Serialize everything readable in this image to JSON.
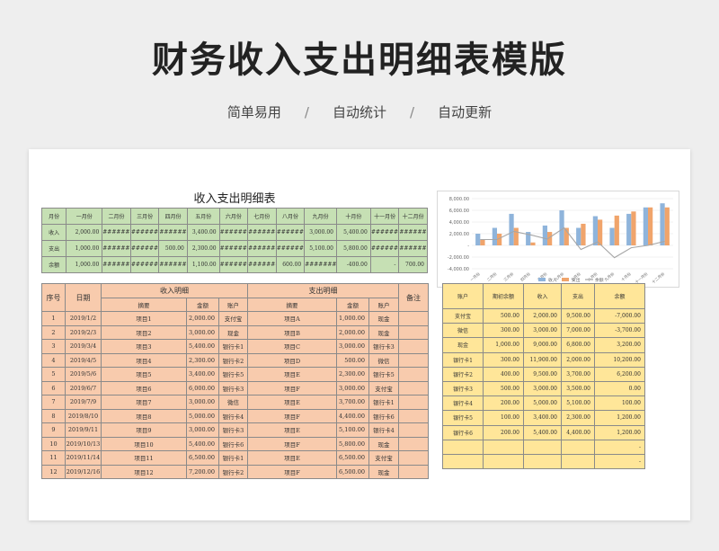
{
  "page": {
    "title": "财务收入支出明细表模版",
    "tags": [
      "简单易用",
      "自动统计",
      "自动更新"
    ],
    "separator": "/"
  },
  "monthly": {
    "title": "收入支出明细表",
    "columns": [
      "月份",
      "一月份",
      "二月份",
      "三月份",
      "四月份",
      "五月份",
      "六月份",
      "七月份",
      "八月份",
      "九月份",
      "十月份",
      "十一月份",
      "十二月份"
    ],
    "rows": [
      [
        "收入",
        "2,000.00",
        "########",
        "########",
        "########",
        "3,400.00",
        "########",
        "########",
        "########",
        "3,000.00",
        "5,400.00",
        "########",
        "########"
      ],
      [
        "支出",
        "1,000.00",
        "########",
        "########",
        "500.00",
        "2,300.00",
        "########",
        "########",
        "########",
        "5,100.00",
        "5,800.00",
        "########",
        "########"
      ],
      [
        "余额",
        "1,000.00",
        "########",
        "########",
        "########",
        "1,100.00",
        "########",
        "########",
        "600.00",
        "########",
        "-400.00",
        "-",
        "700.00"
      ]
    ]
  },
  "detail": {
    "headers": {
      "seq": "序号",
      "date": "日期",
      "income_group": "收入明细",
      "expense_group": "支出明细",
      "note": "备注",
      "summary": "摘要",
      "amount": "金额",
      "account": "账户"
    },
    "rows": [
      [
        "1",
        "2019/1/2",
        "项目1",
        "2,000.00",
        "支付宝",
        "项目A",
        "1,000.00",
        "现金"
      ],
      [
        "2",
        "2019/2/3",
        "项目2",
        "3,000.00",
        "现金",
        "项目B",
        "2,000.00",
        "现金"
      ],
      [
        "3",
        "2019/3/4",
        "项目3",
        "5,400.00",
        "银行卡1",
        "项目C",
        "3,000.00",
        "银行卡3"
      ],
      [
        "4",
        "2019/4/5",
        "项目4",
        "2,300.00",
        "银行卡2",
        "项目D",
        "500.00",
        "微信"
      ],
      [
        "5",
        "2019/5/6",
        "项目5",
        "3,400.00",
        "银行卡5",
        "项目E",
        "2,300.00",
        "银行卡5"
      ],
      [
        "6",
        "2019/6/7",
        "项目6",
        "6,000.00",
        "银行卡3",
        "项目F",
        "3,000.00",
        "支付宝"
      ],
      [
        "7",
        "2019/7/9",
        "项目7",
        "3,000.00",
        "微信",
        "项目E",
        "3,700.00",
        "银行卡1"
      ],
      [
        "8",
        "2019/8/10",
        "项目8",
        "5,000.00",
        "银行卡4",
        "项目F",
        "4,400.00",
        "银行卡6"
      ],
      [
        "9",
        "2019/9/11",
        "项目9",
        "3,000.00",
        "银行卡3",
        "项目E",
        "5,100.00",
        "银行卡4"
      ],
      [
        "10",
        "2019/10/13",
        "项目10",
        "5,400.00",
        "银行卡6",
        "项目F",
        "5,800.00",
        "现金"
      ],
      [
        "11",
        "2019/11/14",
        "项目11",
        "6,500.00",
        "银行卡1",
        "项目E",
        "6,500.00",
        "支付宝"
      ],
      [
        "12",
        "2019/12/16",
        "项目12",
        "7,200.00",
        "银行卡2",
        "项目F",
        "6,500.00",
        "现金"
      ]
    ]
  },
  "accounts": {
    "headers": [
      "账户",
      "期初余额",
      "收入",
      "支出",
      "余额"
    ],
    "rows": [
      [
        "支付宝",
        "500.00",
        "2,000.00",
        "9,500.00",
        "-7,000.00"
      ],
      [
        "微信",
        "300.00",
        "3,000.00",
        "7,000.00",
        "-3,700.00"
      ],
      [
        "现金",
        "1,000.00",
        "9,000.00",
        "6,800.00",
        "3,200.00"
      ],
      [
        "银行卡1",
        "300.00",
        "11,900.00",
        "2,000.00",
        "10,200.00"
      ],
      [
        "银行卡2",
        "400.00",
        "9,500.00",
        "3,700.00",
        "6,200.00"
      ],
      [
        "银行卡3",
        "500.00",
        "3,000.00",
        "3,500.00",
        "0.00"
      ],
      [
        "银行卡4",
        "200.00",
        "5,000.00",
        "5,100.00",
        "100.00"
      ],
      [
        "银行卡5",
        "100.00",
        "3,400.00",
        "2,300.00",
        "1,200.00"
      ],
      [
        "银行卡6",
        "200.00",
        "5,400.00",
        "4,400.00",
        "1,200.00"
      ],
      [
        "",
        "",
        "",
        "",
        "-"
      ],
      [
        "",
        "",
        "",
        "",
        "-"
      ]
    ]
  },
  "chart_data": {
    "type": "bar",
    "categories": [
      "一月份",
      "二月份",
      "三月份",
      "四月份",
      "五月份",
      "六月份",
      "七月份",
      "八月份",
      "九月份",
      "十月份",
      "十一月份",
      "十二月份"
    ],
    "series": [
      {
        "name": "收入",
        "type": "bar",
        "color": "#8fb4db",
        "values": [
          2000,
          3000,
          5400,
          2300,
          3400,
          6000,
          3000,
          5000,
          3000,
          5400,
          6500,
          7200
        ]
      },
      {
        "name": "支出",
        "type": "bar",
        "color": "#f0a46b",
        "values": [
          1000,
          2000,
          3000,
          500,
          2300,
          3000,
          3700,
          4400,
          5100,
          5800,
          6500,
          6500
        ]
      },
      {
        "name": "余额",
        "type": "line",
        "color": "#a6a6a6",
        "values": [
          1000,
          1000,
          2400,
          1800,
          1100,
          3000,
          -700,
          600,
          -2100,
          -400,
          0,
          700
        ]
      }
    ],
    "ylim": [
      -4000,
      8000
    ],
    "yticks": [
      "8,000.00",
      "6,000.00",
      "4,000.00",
      "2,000.00",
      "-",
      "-2,000.00",
      "-4,000.00"
    ],
    "legend_position": "bottom"
  }
}
